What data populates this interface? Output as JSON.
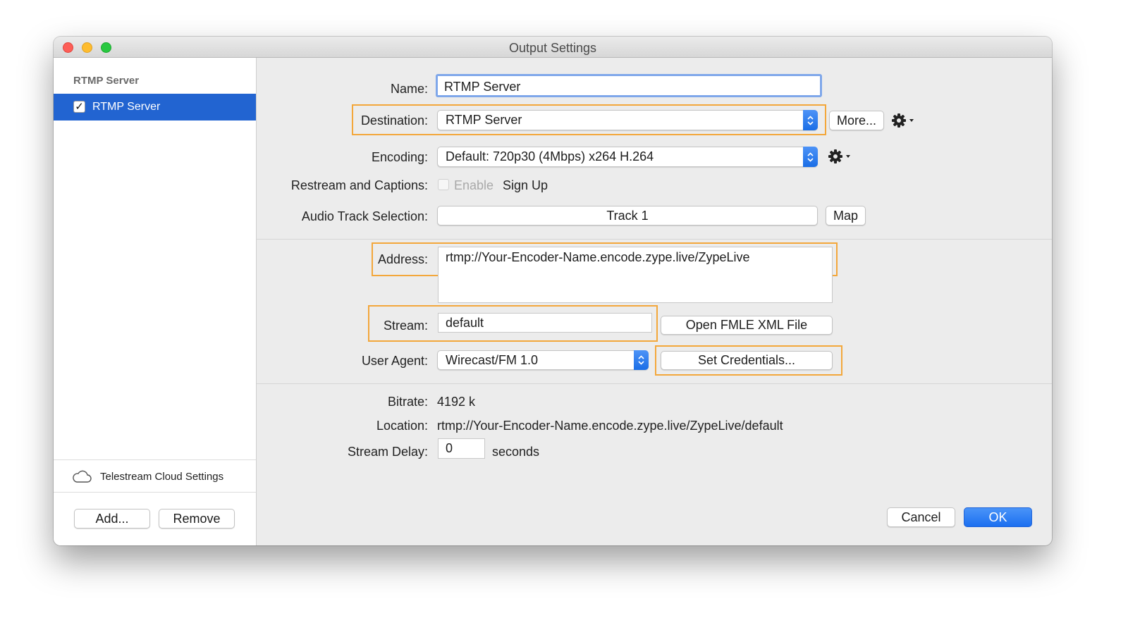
{
  "window": {
    "title": "Output Settings"
  },
  "sidebar": {
    "header": "RTMP Server",
    "items": [
      {
        "label": "RTMP Server",
        "checked": true
      }
    ],
    "cloud_settings_label": "Telestream Cloud Settings",
    "add_label": "Add...",
    "remove_label": "Remove"
  },
  "form": {
    "name": {
      "label": "Name:",
      "value": "RTMP Server"
    },
    "destination": {
      "label": "Destination:",
      "value": "RTMP Server",
      "more_label": "More..."
    },
    "encoding": {
      "label": "Encoding:",
      "value": "Default: 720p30 (4Mbps) x264 H.264"
    },
    "restream": {
      "label": "Restream and Captions:",
      "enable_label": "Enable",
      "signup_label": "Sign Up"
    },
    "audio_track": {
      "label": "Audio Track Selection:",
      "value": "Track 1",
      "map_label": "Map"
    },
    "address": {
      "label": "Address:",
      "value": "rtmp://Your-Encoder-Name.encode.zype.live/ZypeLive"
    },
    "stream": {
      "label": "Stream:",
      "value": "default",
      "open_fmle_label": "Open FMLE XML File"
    },
    "user_agent": {
      "label": "User Agent:",
      "value": "Wirecast/FM 1.0",
      "set_credentials_label": "Set Credentials..."
    },
    "bitrate": {
      "label": "Bitrate:",
      "value": "4192 k"
    },
    "location": {
      "label": "Location:",
      "value": "rtmp://Your-Encoder-Name.encode.zype.live/ZypeLive/default"
    },
    "stream_delay": {
      "label": "Stream Delay:",
      "value": "0",
      "unit": "seconds"
    }
  },
  "footer": {
    "cancel_label": "Cancel",
    "ok_label": "OK"
  },
  "colors": {
    "selection": "#2264d1",
    "highlight": "#f3a73b",
    "accent": "#1c6ff0"
  }
}
